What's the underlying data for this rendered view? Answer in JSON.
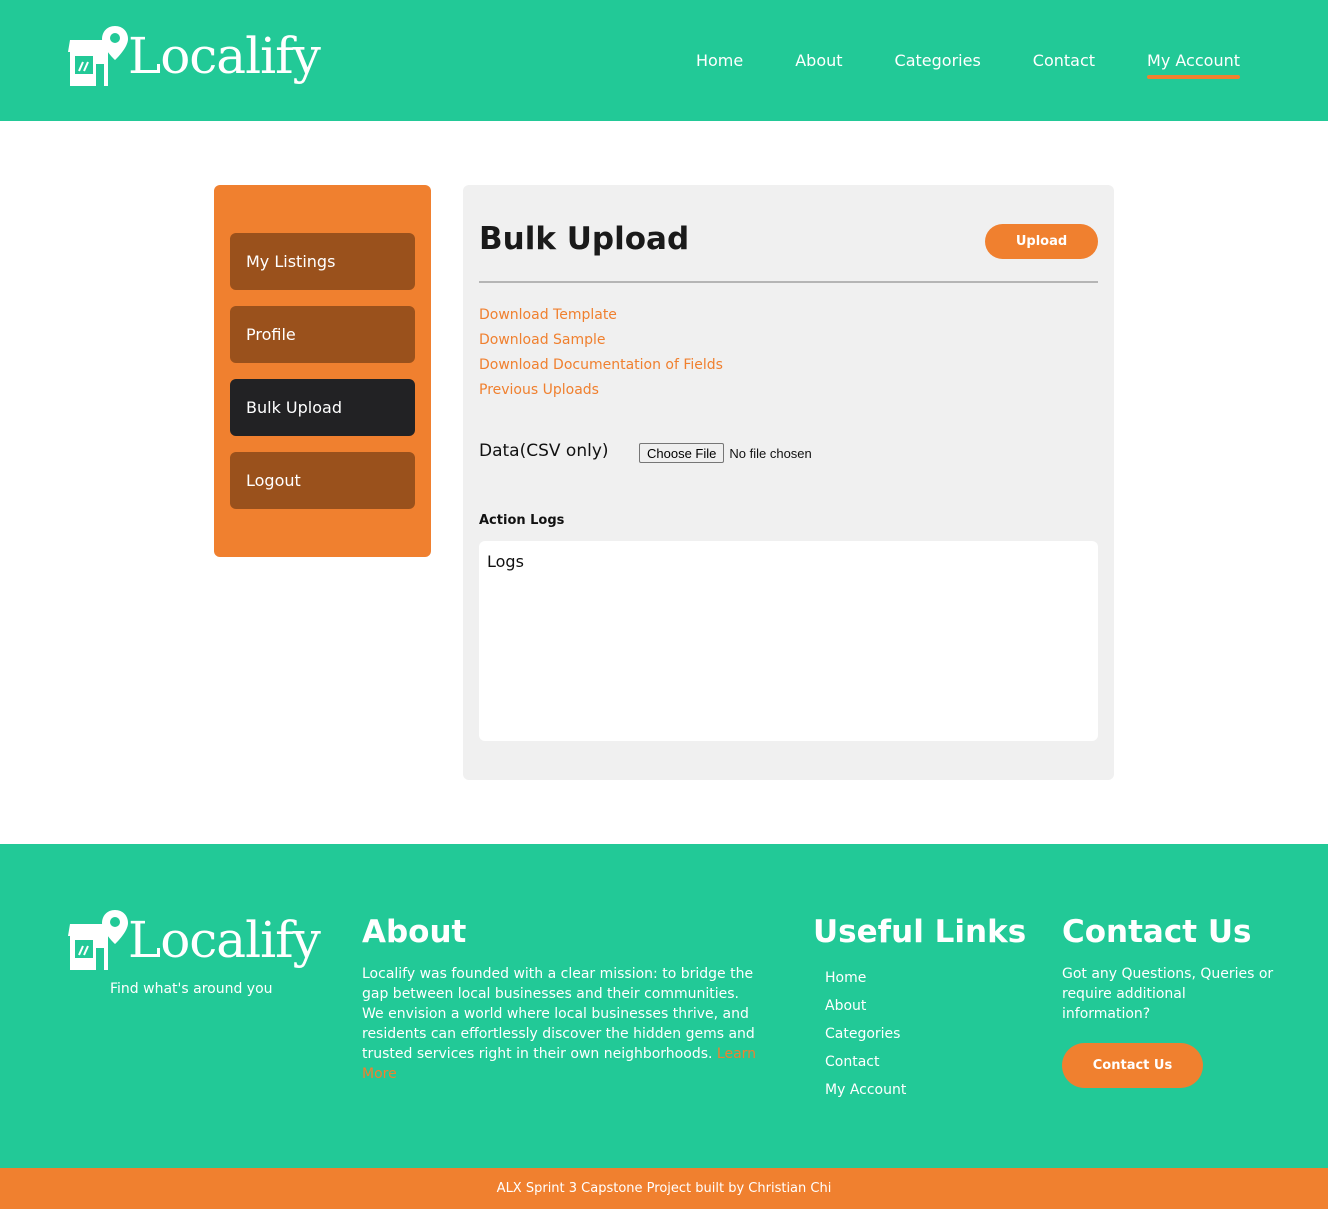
{
  "brand": {
    "name": "Localify",
    "tagline": "Find what's around you"
  },
  "nav": {
    "items": [
      "Home",
      "About",
      "Categories",
      "Contact",
      "My Account"
    ],
    "active": "My Account"
  },
  "sidebar": {
    "items": [
      {
        "label": "My Listings"
      },
      {
        "label": "Profile"
      },
      {
        "label": "Bulk Upload"
      },
      {
        "label": "Logout"
      }
    ],
    "active": "Bulk Upload"
  },
  "main": {
    "title": "Bulk Upload",
    "upload_label": "Upload",
    "links": [
      "Download Template",
      "Download Sample",
      "Download Documentation of Fields",
      "Previous Uploads"
    ],
    "data_label": "Data(CSV only)",
    "file_button": "Choose File",
    "file_status": "No file chosen",
    "logs_label": "Action Logs",
    "logs_text": "Logs"
  },
  "footer": {
    "about_title": "About",
    "about_text": "Localify was founded with a clear mission: to bridge the gap between local businesses and their communities. We envision a world where local businesses thrive, and residents can effortlessly discover the hidden gems and trusted services right in their own neighborhoods. ",
    "about_link": "Learn More",
    "links_title": "Useful Links",
    "links": [
      "Home",
      "About",
      "Categories",
      "Contact",
      "My Account"
    ],
    "contact_title": "Contact Us",
    "contact_text": "Got any Questions, Queries or require additional information?",
    "contact_button": "Contact Us",
    "credit": "ALX Sprint 3 Capstone Project built by Christian Chi"
  },
  "colors": {
    "brand_green": "#22c997",
    "accent_orange": "#f0802f",
    "sidebar_item": "#9a511c",
    "sidebar_active": "#222224"
  }
}
